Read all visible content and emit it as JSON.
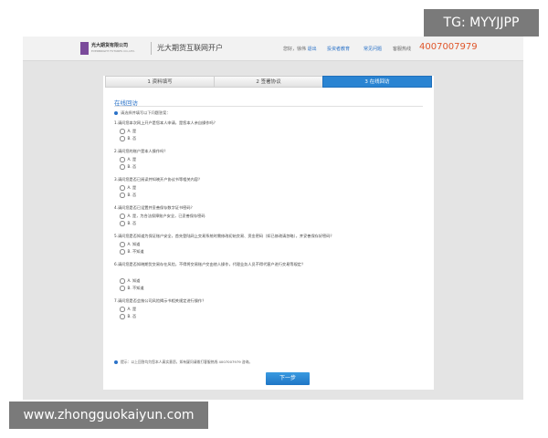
{
  "header": {
    "logo_name": "光大期货有限公司",
    "logo_sub": "EVERBRIGHT FUTURES CO.,LTD.",
    "brand_title": "光大期货互联网开户",
    "user_prefix": "您好，",
    "user_name": "徐伟",
    "logout": "退出",
    "link_education": "投资者教育",
    "link_faq": "常见问题",
    "hotline_label": "客服热线",
    "hotline_number": "4007007979"
  },
  "steps": [
    "1 资料填写",
    "2 签署协议",
    "3 在线回访"
  ],
  "active_step": 2,
  "section": {
    "title": "在线回访",
    "instruction": "请选择并填写以下问题答案："
  },
  "questions": [
    {
      "text": "1.请问您本次网上开户是您本人申请，是您本人亲自操作吗？",
      "options": [
        "A. 是",
        "B. 否"
      ]
    },
    {
      "text": "2.请问您的账户是本人操作吗？",
      "options": [
        "A. 是",
        "B. 否"
      ]
    },
    {
      "text": "3.请问您是否已阅读并知晓开户协议书等相关内容？",
      "options": [
        "A. 是",
        "B. 否"
      ]
    },
    {
      "text": "4.请问您是否已设置并妥善保存数字证书密码？",
      "options": [
        "A. 是，为合法保障账户安全，已妥善保存密码",
        "B. 否"
      ]
    },
    {
      "text": "5.请问您是否知道为保证账户安全，首先登陆网上交易系统时需修改初始交易、资金密码（如已修改请忽略），并妥善保存好密码？",
      "options": [
        "A. 知道",
        "B. 不知道"
      ]
    },
    {
      "text": "6.请问您是否知晓期货交易存在风险，不得将交易账户交由他人操作，代理业务人员不得代客户进行交易等规定？",
      "options": [
        "A. 知道",
        "B. 不知道"
      ]
    },
    {
      "text": "7.请问您是否会按公司风险揭示书相关规定进行操作？",
      "options": [
        "A. 是",
        "B. 否"
      ]
    }
  ],
  "notice": "提示：以上回答均为您本人真实意愿，如有疑问请拨打客服热线 4007007979 咨询。",
  "next_button": "下一步",
  "overlays": {
    "tg_badge": "TG: MYYJJPP",
    "watermark": "www.zhongguokaiyun.com"
  },
  "colors": {
    "accent": "#2a84d2",
    "hotline": "#e0562a",
    "logo": "#7a4a9a"
  }
}
